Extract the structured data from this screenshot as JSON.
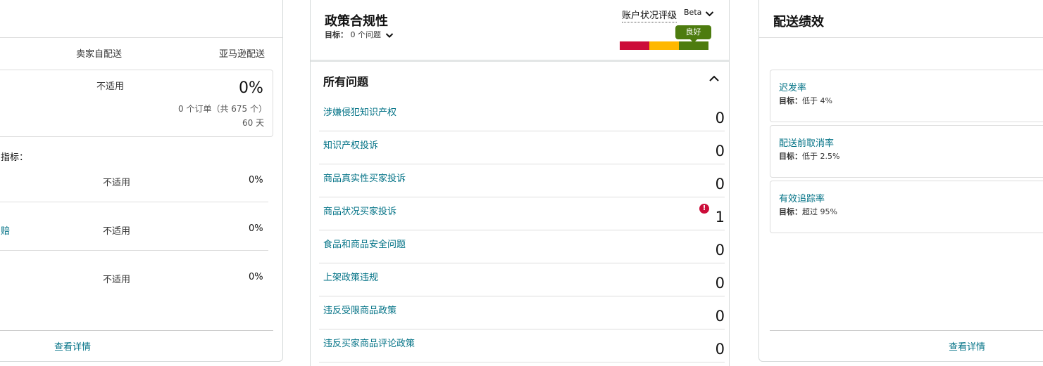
{
  "left_panel": {
    "col_seller": "卖家自配送",
    "col_amazon": "亚马逊配送",
    "seller_value": "不适用",
    "amazon_percent": "0%",
    "amazon_orders": "0 个订单（共 675 个）",
    "amazon_days": "60 天",
    "metrics_label_partial": "指标：",
    "rows": [
      {
        "seller": "不适用",
        "amazon": "0%"
      },
      {
        "link_partial": "赔",
        "seller": "不适用",
        "amazon": "0%"
      },
      {
        "seller": "不适用",
        "amazon": "0%"
      }
    ],
    "details_link": "查看详情"
  },
  "policy_panel": {
    "title": "政策合规性",
    "target_label": "目标：",
    "target_value": "0 个问题",
    "rating_label": "账户状况评级",
    "beta": "Beta",
    "rating_badge": "良好",
    "colors": {
      "poor": "#cc0c39",
      "fair": "#ffb800",
      "good": "#4d7c0f"
    },
    "section_title": "所有问题",
    "issues": [
      {
        "label": "涉嫌侵犯知识产权",
        "count": "0"
      },
      {
        "label": "知识产权投诉",
        "count": "0"
      },
      {
        "label": "商品真实性买家投诉",
        "count": "0"
      },
      {
        "label": "商品状况买家投诉",
        "count": "1",
        "alert": "!"
      },
      {
        "label": "食品和商品安全问题",
        "count": "0"
      },
      {
        "label": "上架政策违规",
        "count": "0"
      },
      {
        "label": "违反受限商品政策",
        "count": "0"
      },
      {
        "label": "违反买家商品评论政策",
        "count": "0"
      }
    ]
  },
  "shipping_panel": {
    "title": "配送绩效",
    "metrics": [
      {
        "label": "迟发率",
        "target_label": "目标：",
        "target_value": "低于 4%"
      },
      {
        "label": "配送前取消率",
        "target_label": "目标：",
        "target_value": "低于 2.5%"
      },
      {
        "label": "有效追踪率",
        "target_label": "目标：",
        "target_value": "超过 95%"
      }
    ],
    "details_link": "查看详情"
  }
}
